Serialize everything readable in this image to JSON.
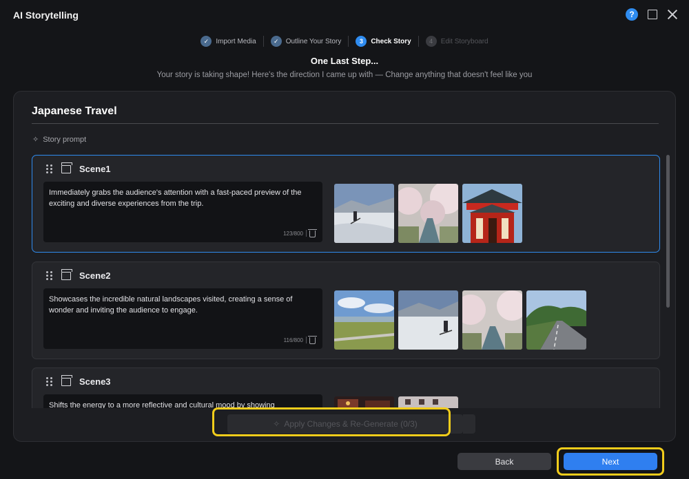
{
  "window": {
    "title": "AI Storytelling",
    "help_icon": "help-icon",
    "help_label": "?",
    "maximize_icon": "maximize-icon",
    "close_icon": "close-icon"
  },
  "stepper": {
    "steps": [
      {
        "number": "1",
        "label": "Import Media",
        "state": "done"
      },
      {
        "number": "2",
        "label": "Outline Your Story",
        "state": "done"
      },
      {
        "number": "3",
        "label": "Check Story",
        "state": "current"
      },
      {
        "number": "4",
        "label": "Edit Storyboard",
        "state": "future"
      }
    ]
  },
  "header": {
    "title": "One Last Step...",
    "subtitle": "Your story is taking shape! Here's the direction I came up with — Change anything that doesn't feel like you"
  },
  "story": {
    "title": "Japanese Travel",
    "prompt_label": "Story prompt",
    "scenes": [
      {
        "name": "Scene1",
        "text": "Immediately grabs the audience's attention with a fast-paced preview of the exciting and diverse experiences from the trip.",
        "count": "123/800",
        "thumbs": [
          "skier-snow",
          "cherry-river",
          "red-temple"
        ]
      },
      {
        "name": "Scene2",
        "text": "Showcases the incredible natural landscapes visited, creating a sense of wonder and inviting the audience to engage.",
        "count": "116/800",
        "thumbs": [
          "coast-grass",
          "skier-snow",
          "cherry-river",
          "country-road"
        ]
      },
      {
        "name": "Scene3",
        "text": "Shifts the energy to a more reflective and cultural mood by showing",
        "count": "",
        "thumbs": [
          "street-night",
          "street-building"
        ]
      }
    ]
  },
  "actions": {
    "regenerate_label": "Apply Changes & Re-Generate (0/3)",
    "back_label": "Back",
    "next_label": "Next"
  },
  "colors": {
    "accent": "#2f8cf0",
    "highlight": "#f2cd1b",
    "background": "#141518",
    "panel": "#1d1e22"
  }
}
